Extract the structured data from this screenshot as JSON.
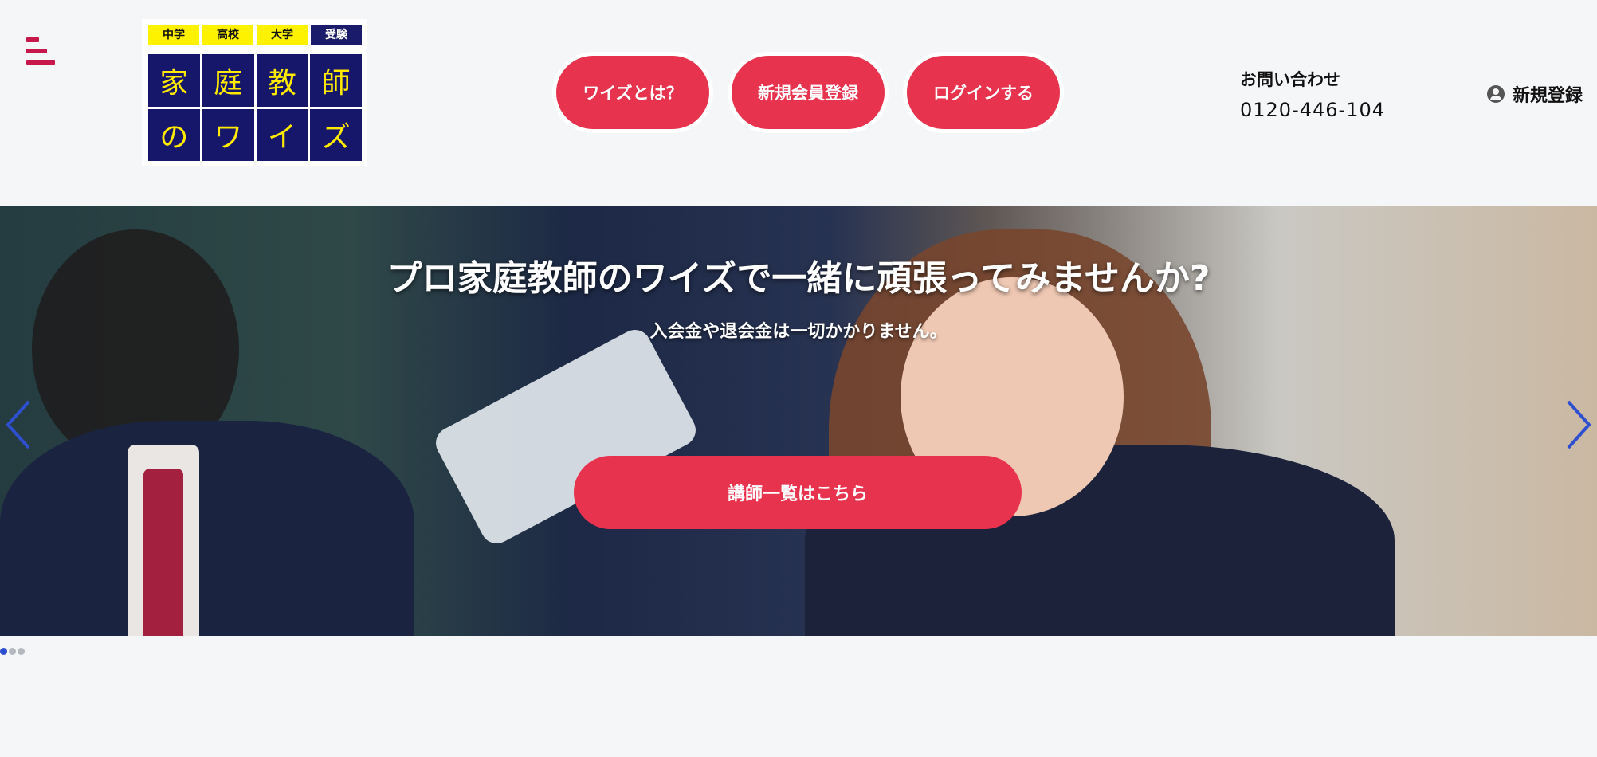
{
  "header": {
    "menu_icon": "hamburger-icon",
    "logo": {
      "tags": [
        "中学",
        "高校",
        "大学",
        "受験"
      ],
      "cells": [
        "家",
        "庭",
        "教",
        "師",
        "の",
        "ワ",
        "イ",
        "ズ"
      ]
    },
    "nav": [
      {
        "label": "ワイズとは？"
      },
      {
        "label": "新規会員登録"
      },
      {
        "label": "ログインする"
      }
    ],
    "contact": {
      "label": "お問い合わせ",
      "tel": "0120-446-104"
    },
    "register": {
      "icon": "user-icon",
      "label": "新規登録"
    }
  },
  "hero": {
    "title": "プロ家庭教師のワイズで一緒に頑張ってみませんか?",
    "subtitle": "入会金や退会金は一切かかりません。",
    "cta": "講師一覧はこちら",
    "prev_icon": "chevron-left-icon",
    "next_icon": "chevron-right-icon"
  },
  "colors": {
    "accent": "#e8334f",
    "menu": "#c8174a",
    "logo_bg": "#16166a",
    "logo_text": "#ffea00",
    "arrow": "#2f4fd1"
  },
  "carousel": {
    "slides": 3,
    "active": 1
  }
}
